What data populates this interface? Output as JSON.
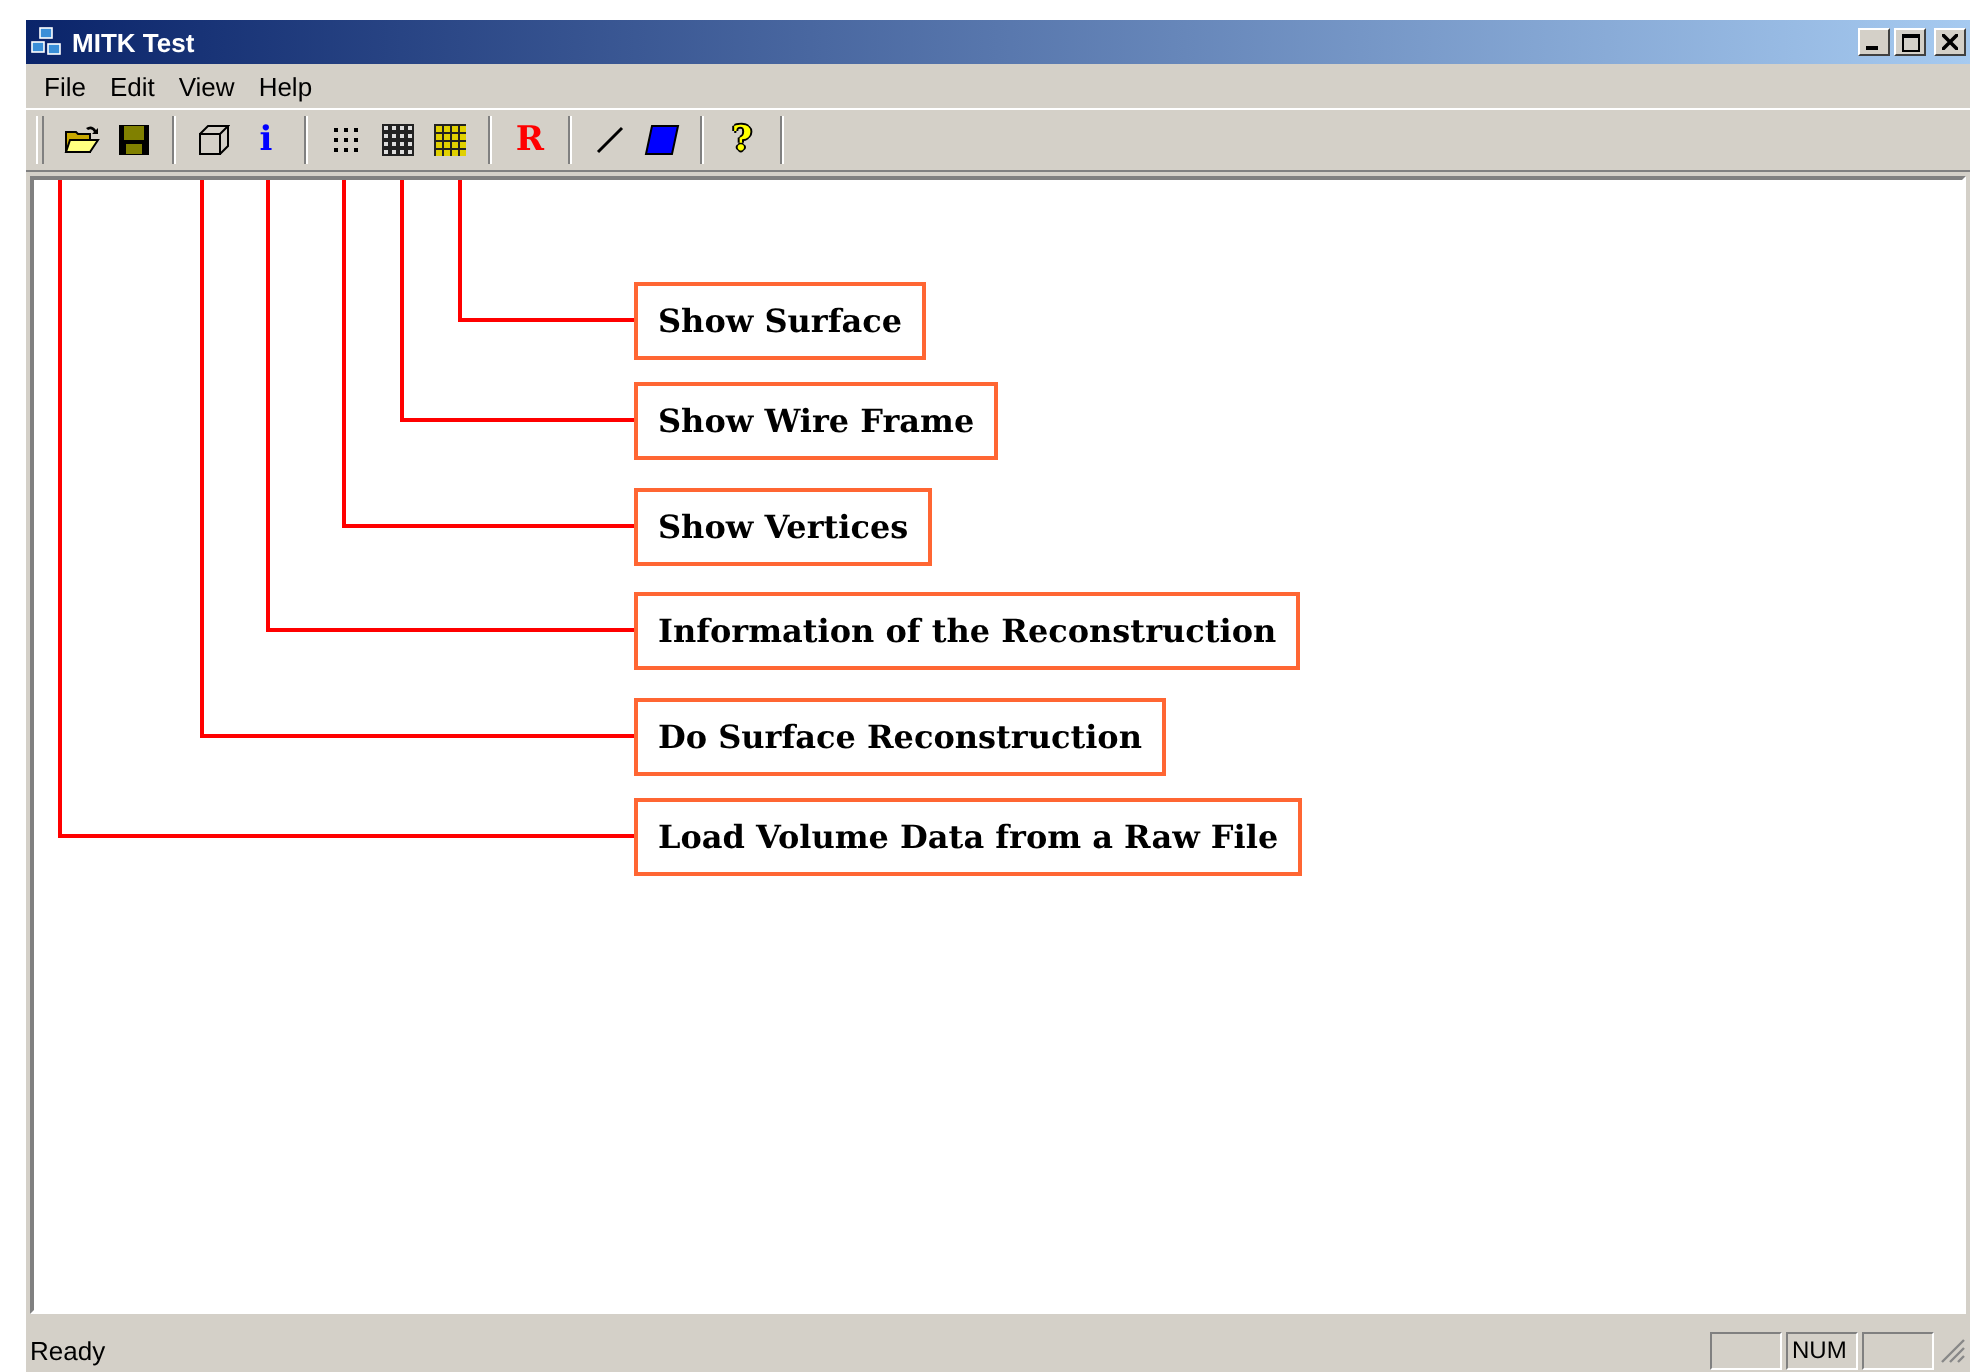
{
  "window": {
    "title": "MITK Test"
  },
  "menu": [
    "File",
    "Edit",
    "View",
    "Help"
  ],
  "toolbar": [
    {
      "kind": "open"
    },
    {
      "kind": "save"
    },
    {
      "kind": "separator"
    },
    {
      "kind": "cube"
    },
    {
      "kind": "glyph",
      "text": "i",
      "color": "#0000ff"
    },
    {
      "kind": "separator"
    },
    {
      "kind": "vertices"
    },
    {
      "kind": "wireframe"
    },
    {
      "kind": "surface"
    },
    {
      "kind": "separator"
    },
    {
      "kind": "glyph",
      "text": "R",
      "color": "#ff0000"
    },
    {
      "kind": "separator"
    },
    {
      "kind": "line"
    },
    {
      "kind": "quad"
    },
    {
      "kind": "separator"
    },
    {
      "kind": "glyph",
      "text": "?",
      "color": "#ffff00"
    },
    {
      "kind": "separator"
    }
  ],
  "annotations": [
    "Show Surface",
    "Show Wire Frame",
    "Show Vertices",
    "Information of the Reconstruction",
    "Do Surface Reconstruction",
    "Load Volume Data from a Raw File"
  ],
  "status_bar": {
    "text": "Ready",
    "indicators": [
      "NUM"
    ]
  }
}
